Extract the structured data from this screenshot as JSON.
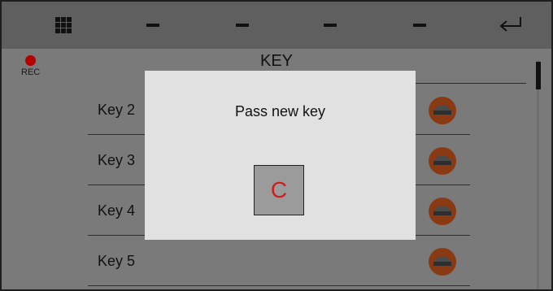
{
  "toolbar": {
    "buttons": [
      {
        "icon": "grid-icon"
      },
      {
        "icon": "minus-icon"
      },
      {
        "icon": "minus-icon"
      },
      {
        "icon": "minus-icon"
      },
      {
        "icon": "minus-icon"
      },
      {
        "icon": "enter-icon"
      }
    ]
  },
  "status": {
    "rec_label": "REC",
    "rec_color": "#b50000"
  },
  "page": {
    "title": "KEY"
  },
  "keys": [
    {
      "label": "Key 2"
    },
    {
      "label": "Key 3"
    },
    {
      "label": "Key 4"
    },
    {
      "label": "Key 5"
    }
  ],
  "row_icon": {
    "name": "key-fob-icon",
    "color": "#8a3a12"
  },
  "modal": {
    "title": "Pass new key",
    "clear_label": "C",
    "clear_color": "#d51a1a"
  }
}
